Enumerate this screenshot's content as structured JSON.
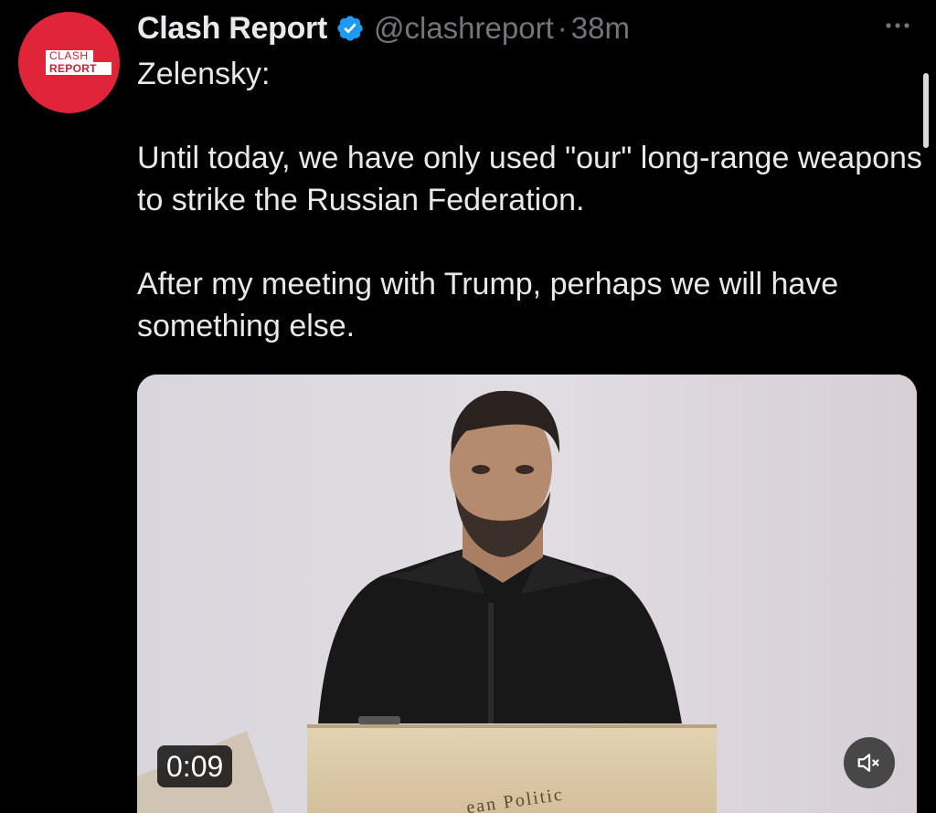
{
  "tweet": {
    "author": {
      "display_name": "Clash Report",
      "handle": "@clashreport",
      "separator": "·",
      "time": "38m",
      "verified": true,
      "avatar_logo": {
        "line1": "CLASH",
        "line2": "REPORT"
      }
    },
    "text": {
      "line1": "Zelensky:",
      "para2": "Until today, we have only used \"our\" long-range weapons to strike the Russian Federation.",
      "para3": "After my meeting with Trump, perhaps we will have something else."
    },
    "media": {
      "type": "video",
      "duration": "0:09",
      "podium_text": "ean Politic",
      "muted": true
    },
    "more_icon": "more-horizontal-icon"
  },
  "colors": {
    "background": "#000000",
    "text_primary": "#e7e9ea",
    "text_secondary": "#71767b",
    "verified_badge": "#1d9bf0",
    "avatar_red": "#e0243a"
  }
}
